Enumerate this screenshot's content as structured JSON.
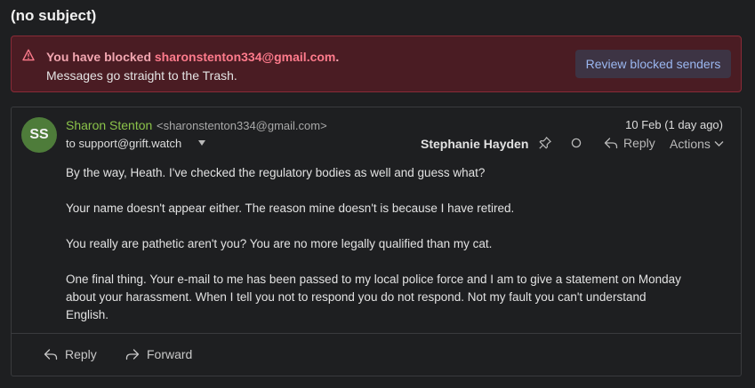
{
  "subject": "(no subject)",
  "banner": {
    "prefix": "You have blocked ",
    "email": "sharonstenton334@gmail.com",
    "suffix": ".",
    "line2": "Messages go straight to the Trash.",
    "review_label": "Review blocked senders"
  },
  "message": {
    "avatar_initials": "SS",
    "sender_name": "Sharon Stenton",
    "sender_email": "<sharonstenton334@gmail.com>",
    "to": "to support@grift.watch",
    "date": "10 Feb (1 day ago)",
    "assignee": "Stephanie Hayden",
    "reply_label": "Reply",
    "actions_label": "Actions",
    "paragraphs": [
      "By the way, Heath.  I've checked the regulatory bodies as well and guess what?",
      "Your name doesn't appear either.  The reason mine doesn't is because I have retired.",
      "You really are pathetic aren't you?  You are no more legally qualified than  my cat.",
      "One final thing.  Your e-mail to me has been passed to my local police force and I am to give a statement on Monday about your harassment.  When I tell you not to respond you do not respond.  Not my fault you can't understand English."
    ]
  },
  "footer": {
    "reply_label": "Reply",
    "forward_label": "Forward"
  },
  "colors": {
    "accent_green": "#8bc34a",
    "banner_bg": "#4a1c23",
    "link_blue": "#9bb7f0"
  }
}
